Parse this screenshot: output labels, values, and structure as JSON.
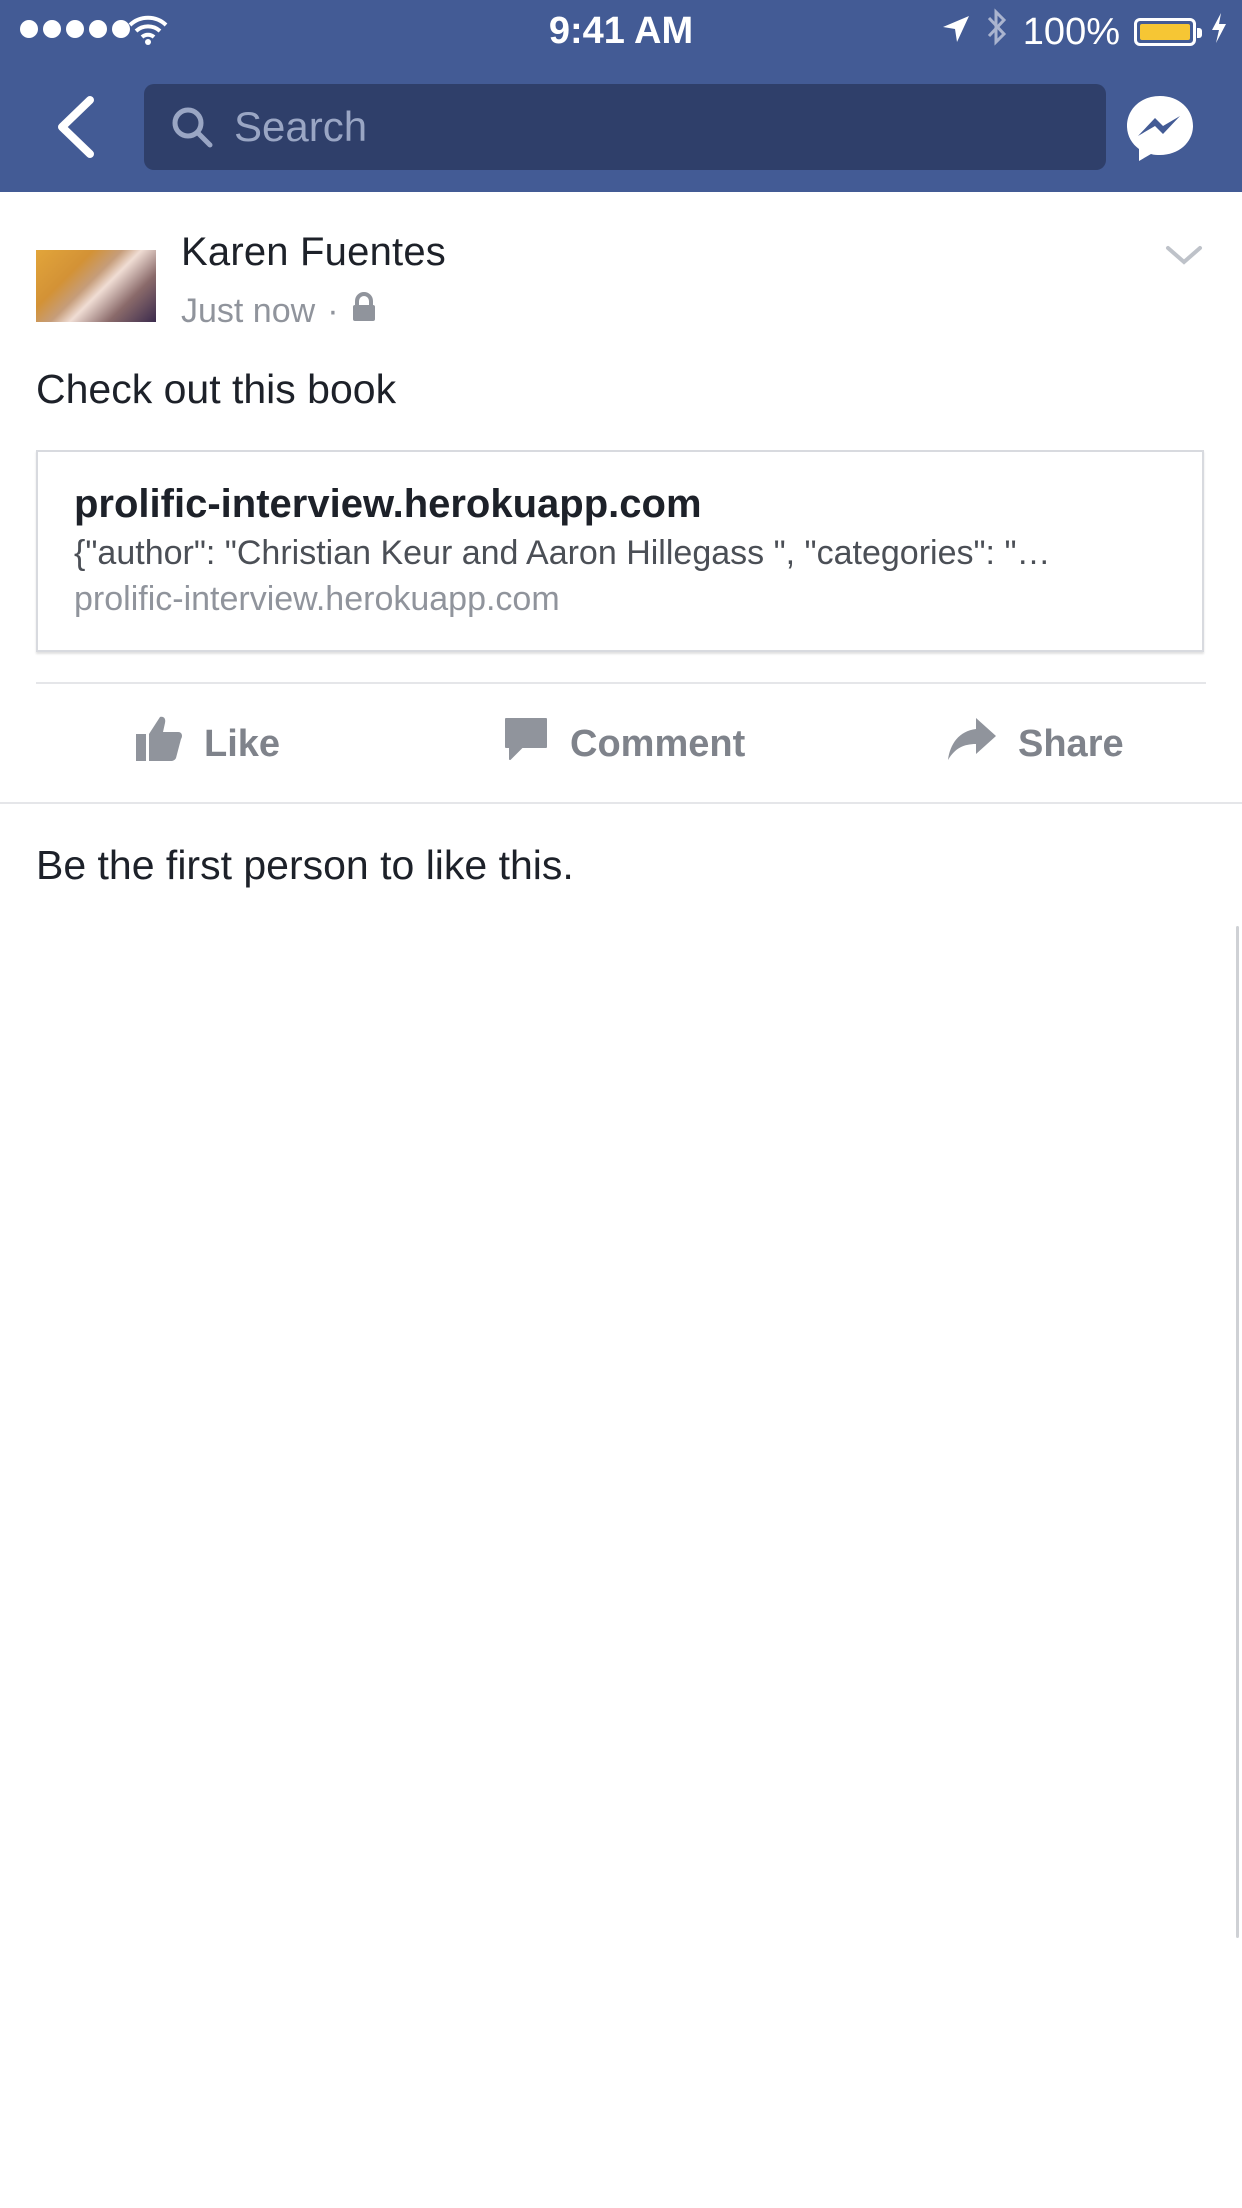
{
  "status_bar": {
    "time": "9:41 AM",
    "battery": "100%"
  },
  "nav": {
    "search_placeholder": "Search"
  },
  "post": {
    "author": "Karen Fuentes",
    "timestamp": "Just now",
    "separator": "·",
    "text": "Check out this book",
    "link": {
      "title": "prolific-interview.herokuapp.com",
      "description": "{\"author\": \"Christian Keur and Aaron Hillegass \", \"categories\": \"…",
      "domain": "prolific-interview.herokuapp.com"
    },
    "actions": {
      "like": "Like",
      "comment": "Comment",
      "share": "Share"
    },
    "likes_text": "Be the first person to like this."
  },
  "colors": {
    "header": "#435b95",
    "search_box": "#2f3f6a",
    "battery": "#f6c634",
    "action_text": "#7f838b"
  }
}
